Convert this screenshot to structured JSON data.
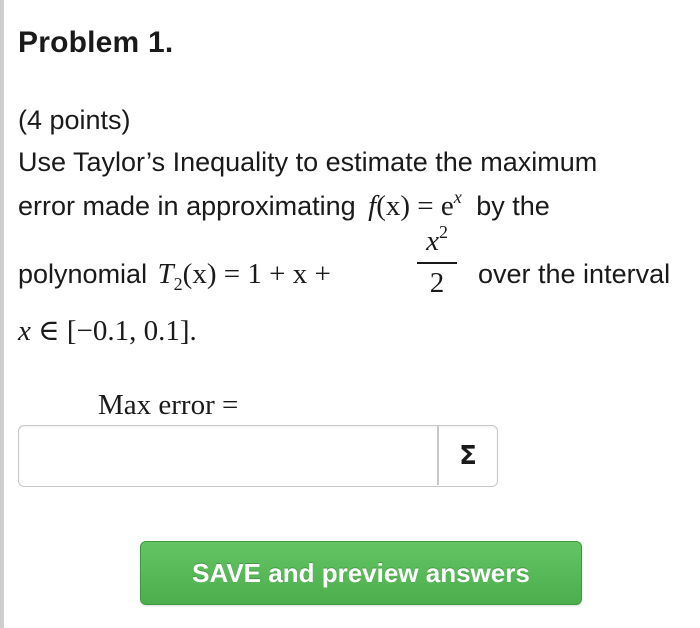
{
  "problem": {
    "title": "Problem 1.",
    "points": "(4 points)",
    "line1": "Use Taylor’s Inequality to estimate the maximum",
    "line2_text": "error made in approximating",
    "line2_math_f": "f",
    "line2_math_fx": "(x) = e",
    "line2_math_exp": "x",
    "line2_tail": "by the",
    "line3_text": "polynomial",
    "line3_T": "T",
    "line3_T_sub": "2",
    "line3_T_rest": "(x) = 1 + x +",
    "frac_num_var": "x",
    "frac_num_exp": "2",
    "frac_den": "2",
    "line3_tail": "over the interval",
    "line4_var": "x",
    "line4_rest": " ∈ [−0.1, 0.1]."
  },
  "answer": {
    "label": "Max error =",
    "value": "",
    "placeholder": "",
    "sigma_icon": "Σ"
  },
  "actions": {
    "save_label": "SAVE and preview answers"
  },
  "colors": {
    "save_button": "#5cb85c",
    "save_text": "#ffffff",
    "border": "#c8c8c8"
  }
}
